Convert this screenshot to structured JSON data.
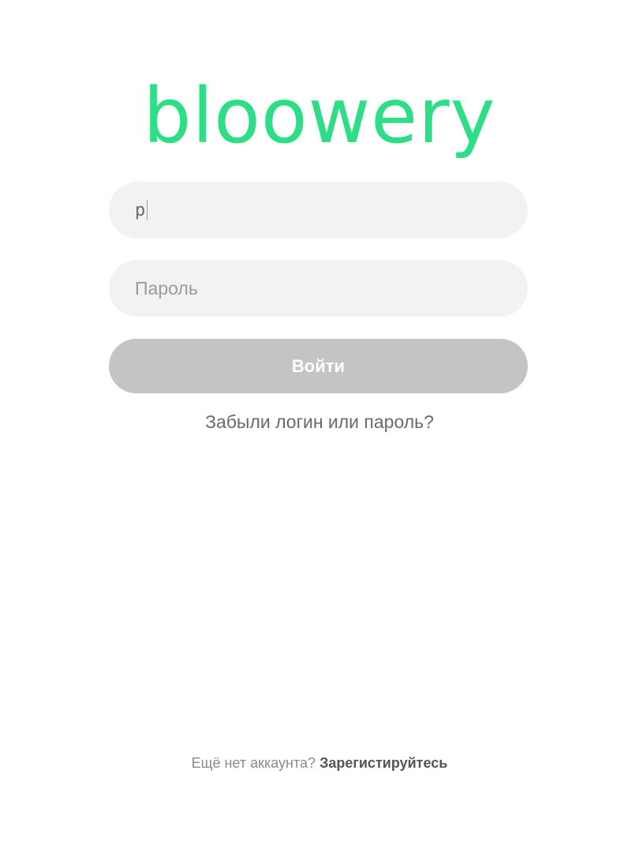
{
  "logo": {
    "text": "bloowery"
  },
  "login_field": {
    "value": "p"
  },
  "password_field": {
    "placeholder": "Пароль"
  },
  "submit_button": {
    "label": "Войти"
  },
  "forgot_link": {
    "label": "Забыли логин или пароль?"
  },
  "register": {
    "prompt": "Ещё нет аккаунта?",
    "link_label": "Зарегистируйтесь"
  },
  "colors": {
    "brand": "#2ede86",
    "field_bg": "#f2f2f2",
    "button_disabled": "#c4c4c4"
  }
}
